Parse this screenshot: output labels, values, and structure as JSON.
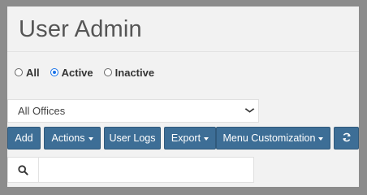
{
  "page": {
    "title": "User Admin"
  },
  "filters": {
    "status_options": [
      {
        "label": "All",
        "checked": false
      },
      {
        "label": "Active",
        "checked": true
      },
      {
        "label": "Inactive",
        "checked": false
      }
    ],
    "office_select": {
      "selected": "All Offices"
    }
  },
  "toolbar": {
    "add_label": "Add",
    "actions_label": "Actions",
    "user_logs_label": "User Logs",
    "export_label": "Export",
    "menu_customization_label": "Menu Customization",
    "refresh_icon": "refresh-icon"
  },
  "search": {
    "icon": "search-icon",
    "value": "",
    "placeholder": ""
  },
  "colors": {
    "button_bg": "#3d6e96",
    "radio_accent": "#1a73e8",
    "frame": "#8c8c8c",
    "panel_bg": "#f2f2f2"
  }
}
